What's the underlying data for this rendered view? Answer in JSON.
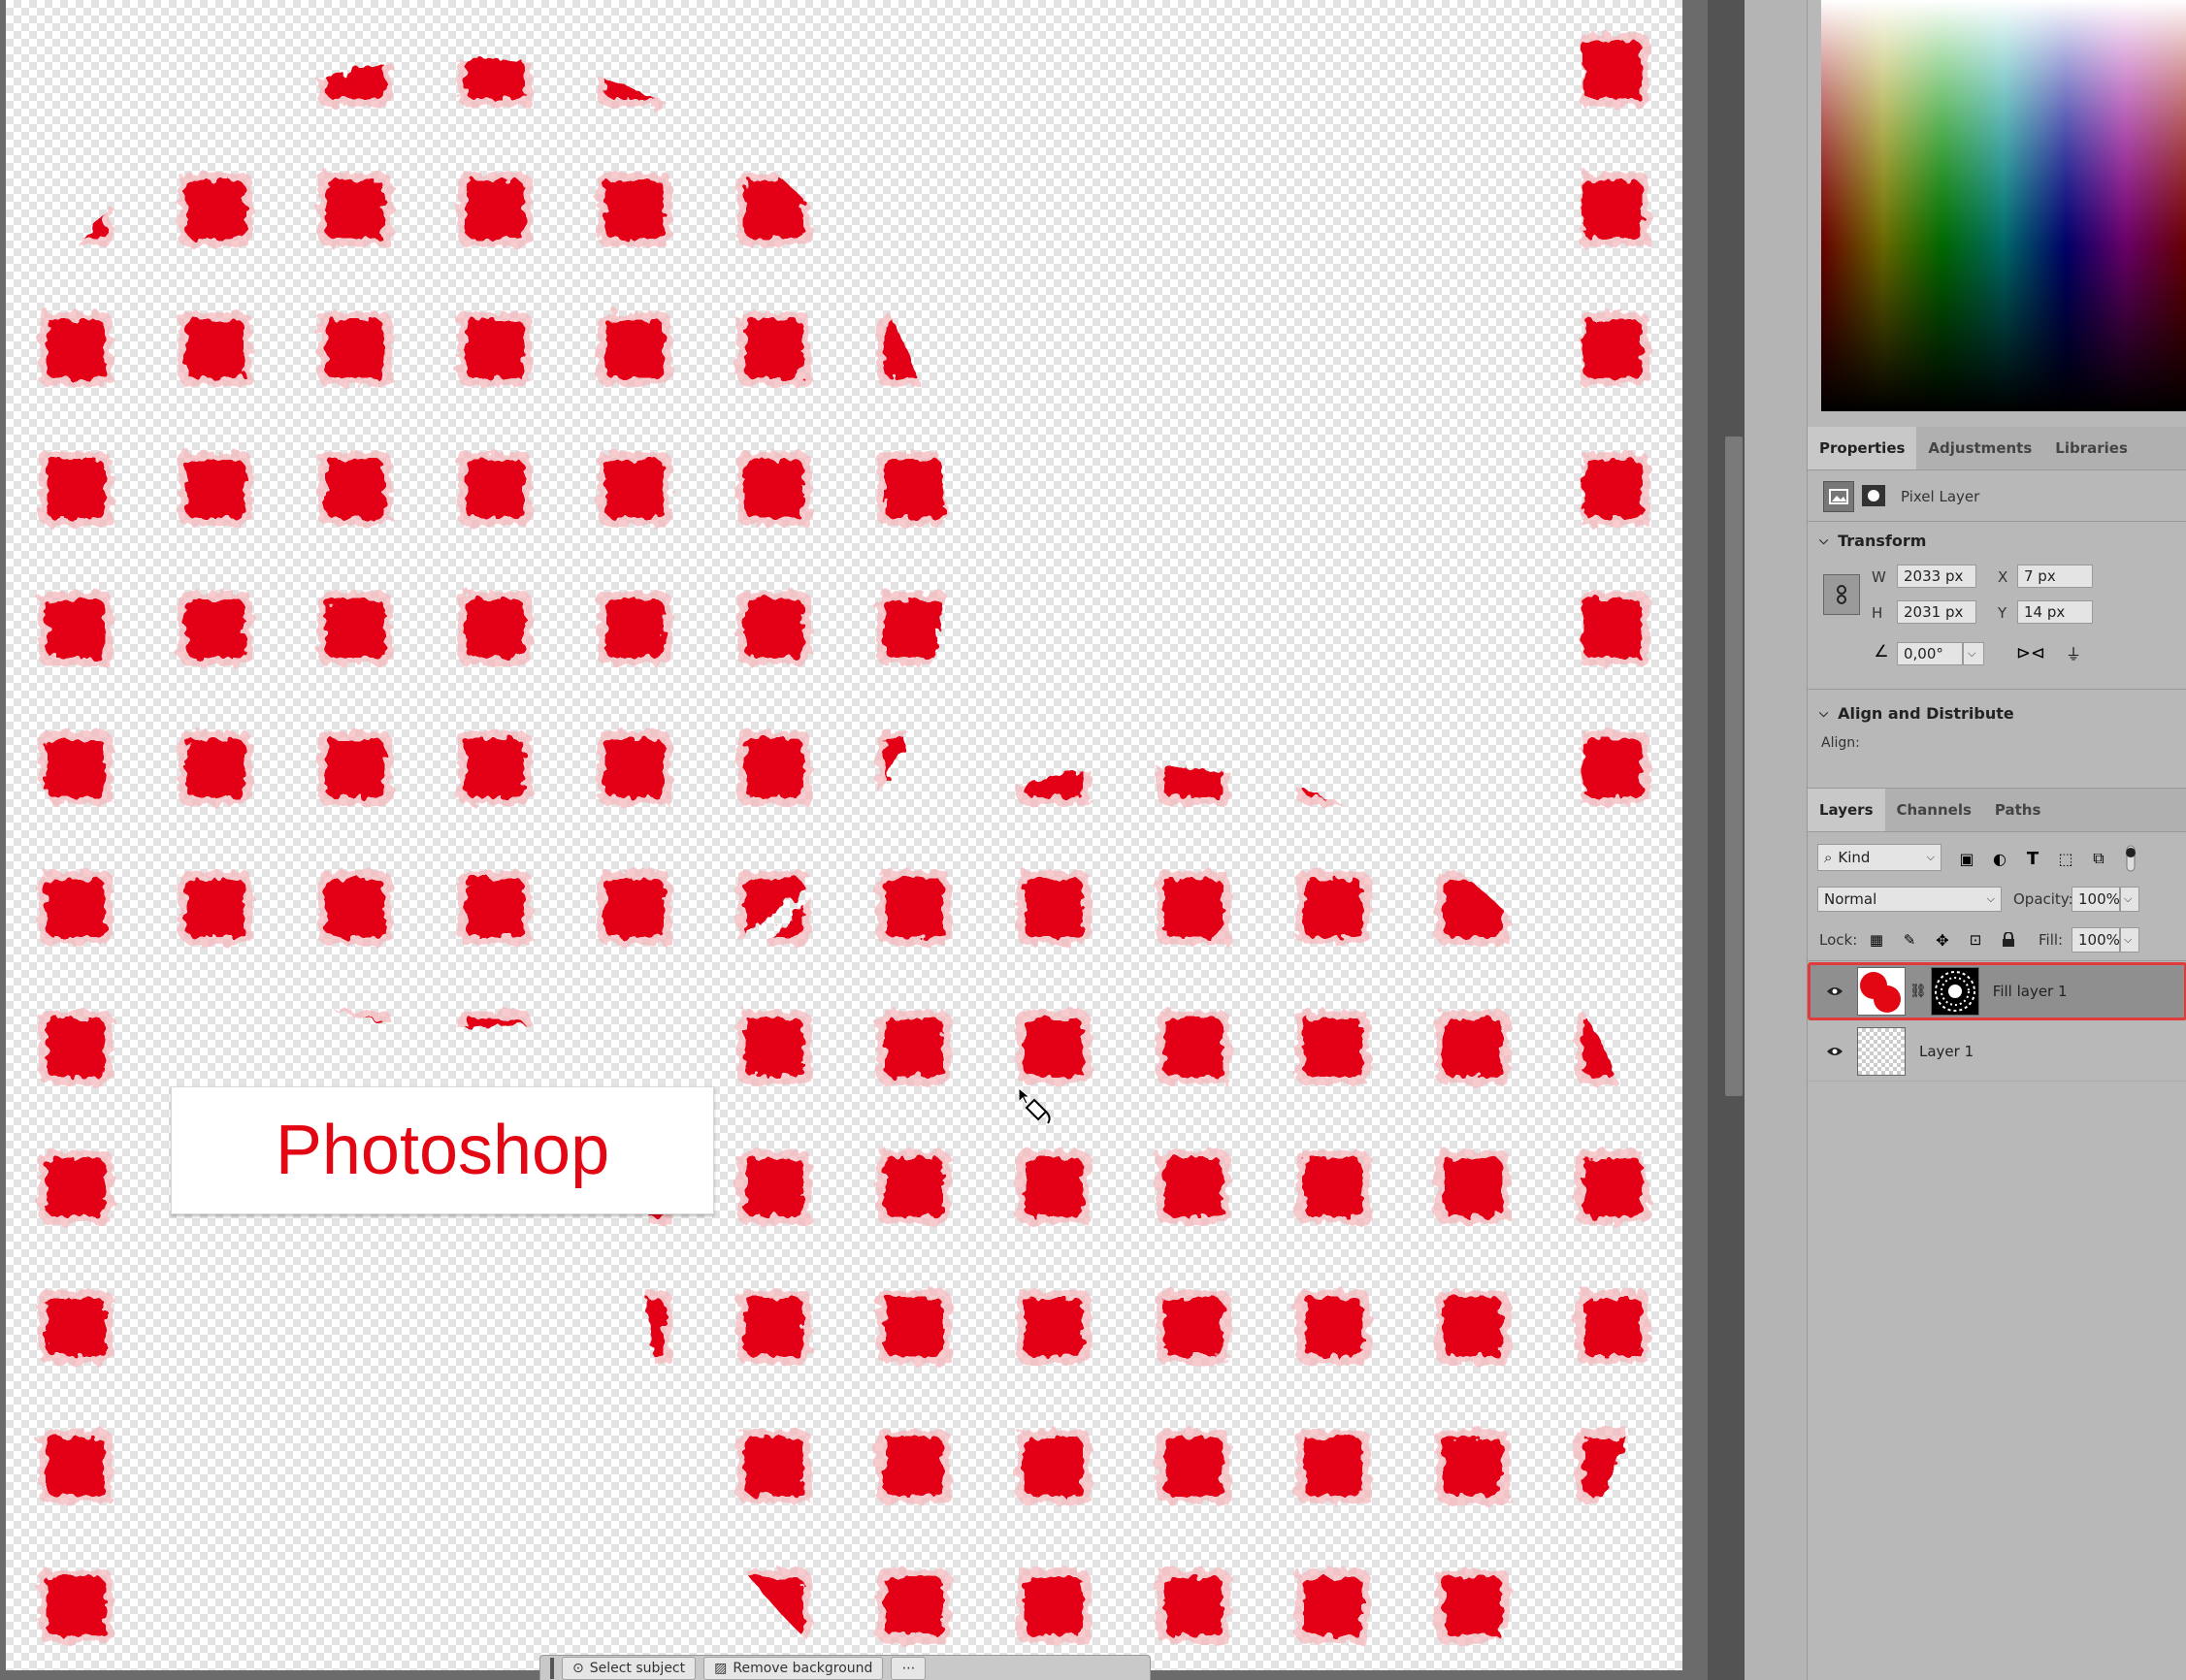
{
  "canvas": {
    "text_box_label": "Photoshop",
    "fill_color": "#e30613"
  },
  "task_bar": {
    "select_subject_label": "Select subject",
    "remove_background_label": "Remove background"
  },
  "properties_tabs": [
    {
      "label": "Properties",
      "active": true
    },
    {
      "label": "Adjustments",
      "active": false
    },
    {
      "label": "Libraries",
      "active": false
    }
  ],
  "properties": {
    "layer_type": "Pixel Layer",
    "transform": {
      "title": "Transform",
      "w_label": "W",
      "w_value": "2033 px",
      "h_label": "H",
      "h_value": "2031 px",
      "x_label": "X",
      "x_value": "7 px",
      "y_label": "Y",
      "y_value": "14 px",
      "angle_value": "0,00°"
    },
    "align": {
      "title": "Align and Distribute",
      "align_label": "Align:"
    }
  },
  "layers_tabs": [
    {
      "label": "Layers",
      "active": true
    },
    {
      "label": "Channels",
      "active": false
    },
    {
      "label": "Paths",
      "active": false
    }
  ],
  "layers_panel": {
    "filter_kind": "Kind",
    "blend_mode": "Normal",
    "opacity_label": "Opacity:",
    "opacity_value": "100%",
    "lock_label": "Lock:",
    "fill_label": "Fill:",
    "fill_value": "100%",
    "layers": [
      {
        "name": "Fill layer 1",
        "selected": true
      },
      {
        "name": "Layer 1",
        "selected": false
      }
    ]
  }
}
